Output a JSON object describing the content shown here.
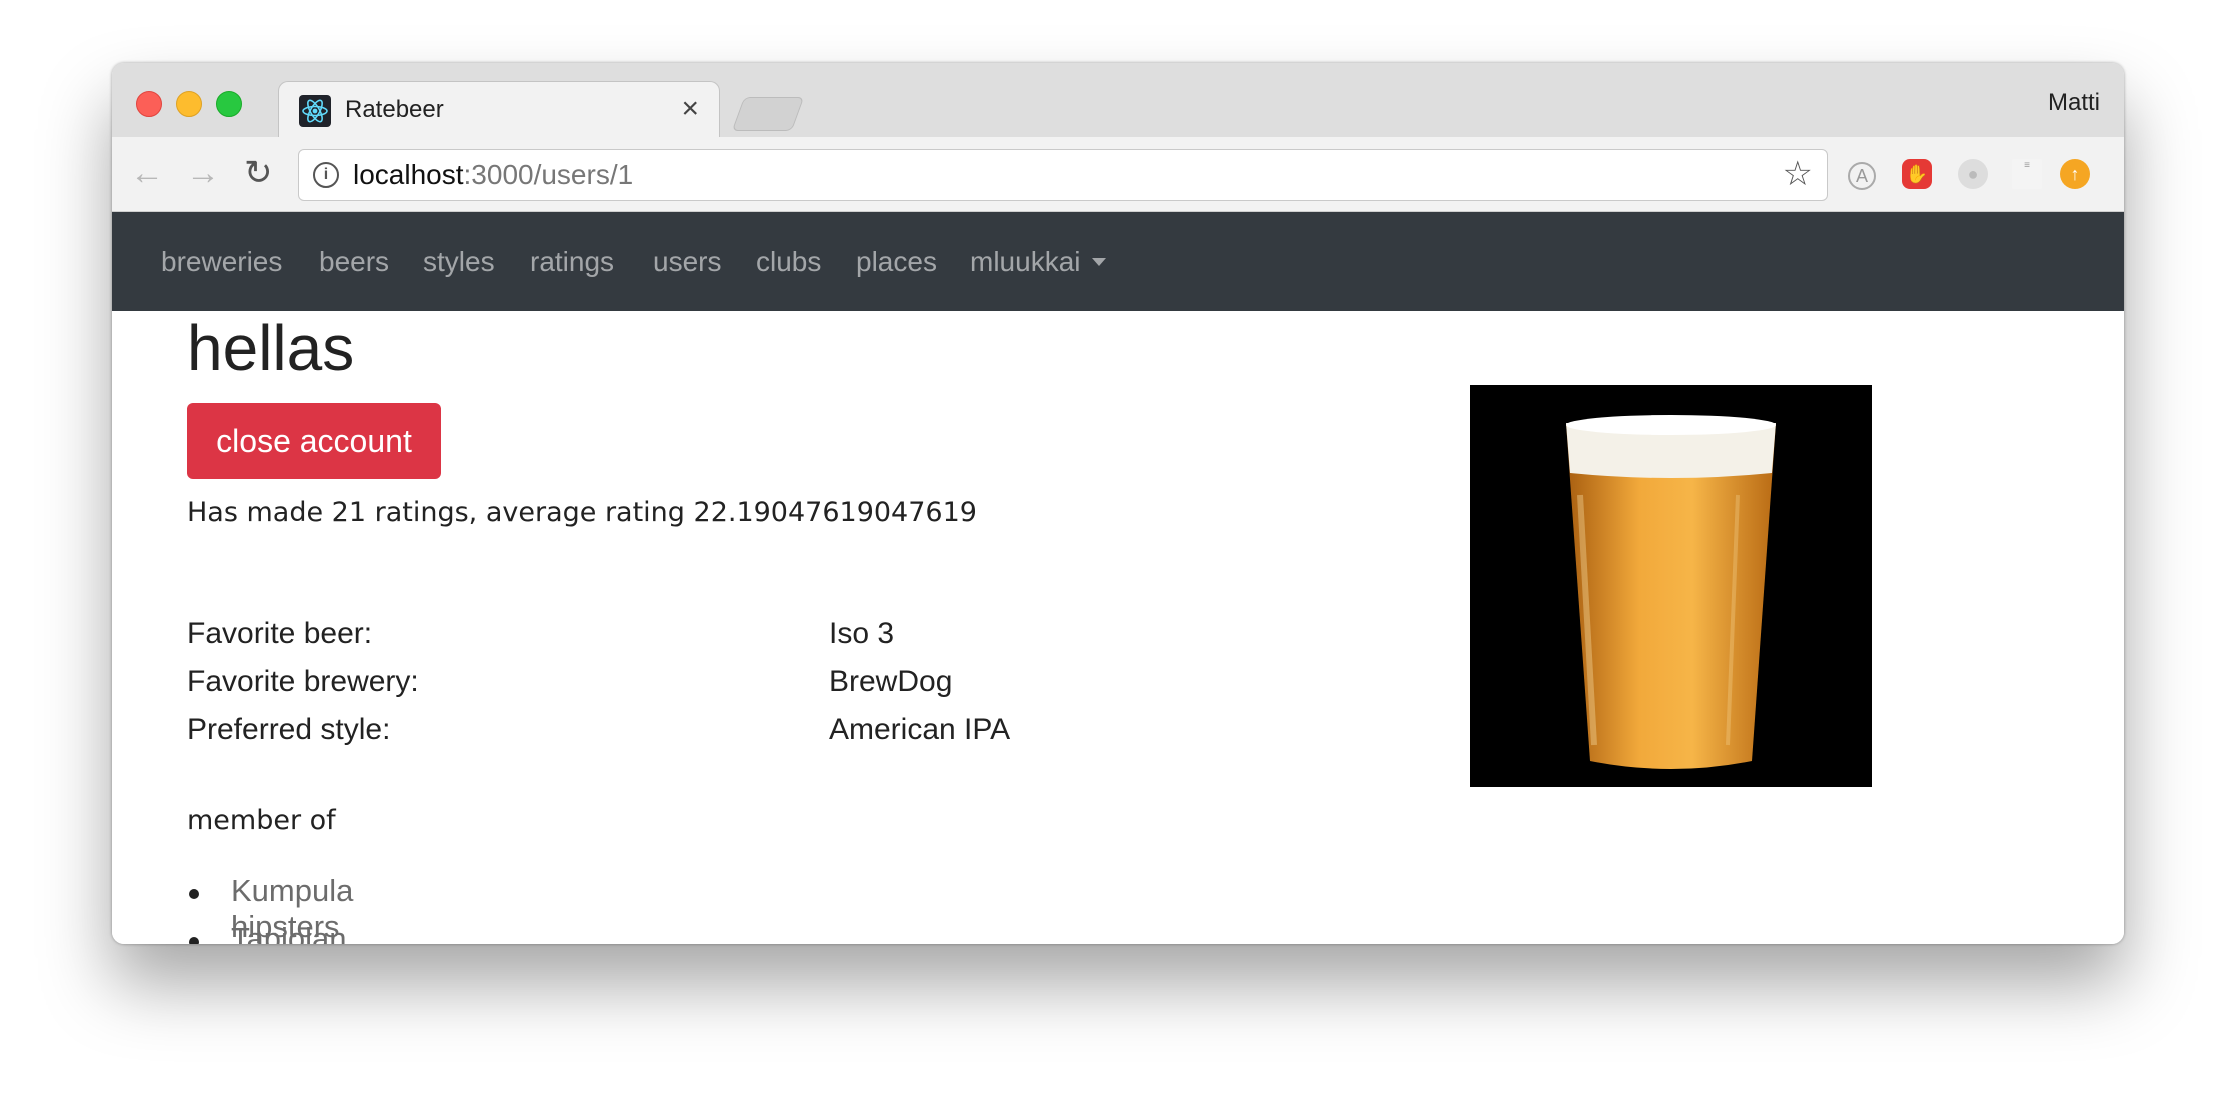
{
  "browser": {
    "tab_title": "Ratebeer",
    "tab_close": "×",
    "profile_name": "Matti",
    "url_host": "localhost",
    "url_path": ":3000/users/1"
  },
  "icons": {
    "back": "arrow-left-icon",
    "forward": "arrow-right-icon",
    "reload": "reload-icon",
    "info": "info-icon",
    "bookmark": "star-icon",
    "favicon": "react-icon"
  },
  "navbar": {
    "items": [
      "breweries",
      "beers",
      "styles",
      "ratings",
      "users",
      "clubs",
      "places"
    ],
    "user_dropdown": "mluukkai"
  },
  "user": {
    "name": "hellas",
    "close_account_label": "close account",
    "summary": "Has made 21 ratings, average rating 22.19047619047619",
    "favorites": [
      {
        "label": "Favorite beer:",
        "value": "Iso 3"
      },
      {
        "label": "Favorite brewery:",
        "value": "BrewDog"
      },
      {
        "label": "Preferred style:",
        "value": "American IPA"
      }
    ],
    "member_of_label": "member of",
    "clubs": [
      "Kumpula hipsters",
      "Tapiolan akateeminen olutseura"
    ]
  },
  "colors": {
    "navbar_bg": "#343a40",
    "danger": "#dc3545",
    "link": "#6c6c6c"
  }
}
